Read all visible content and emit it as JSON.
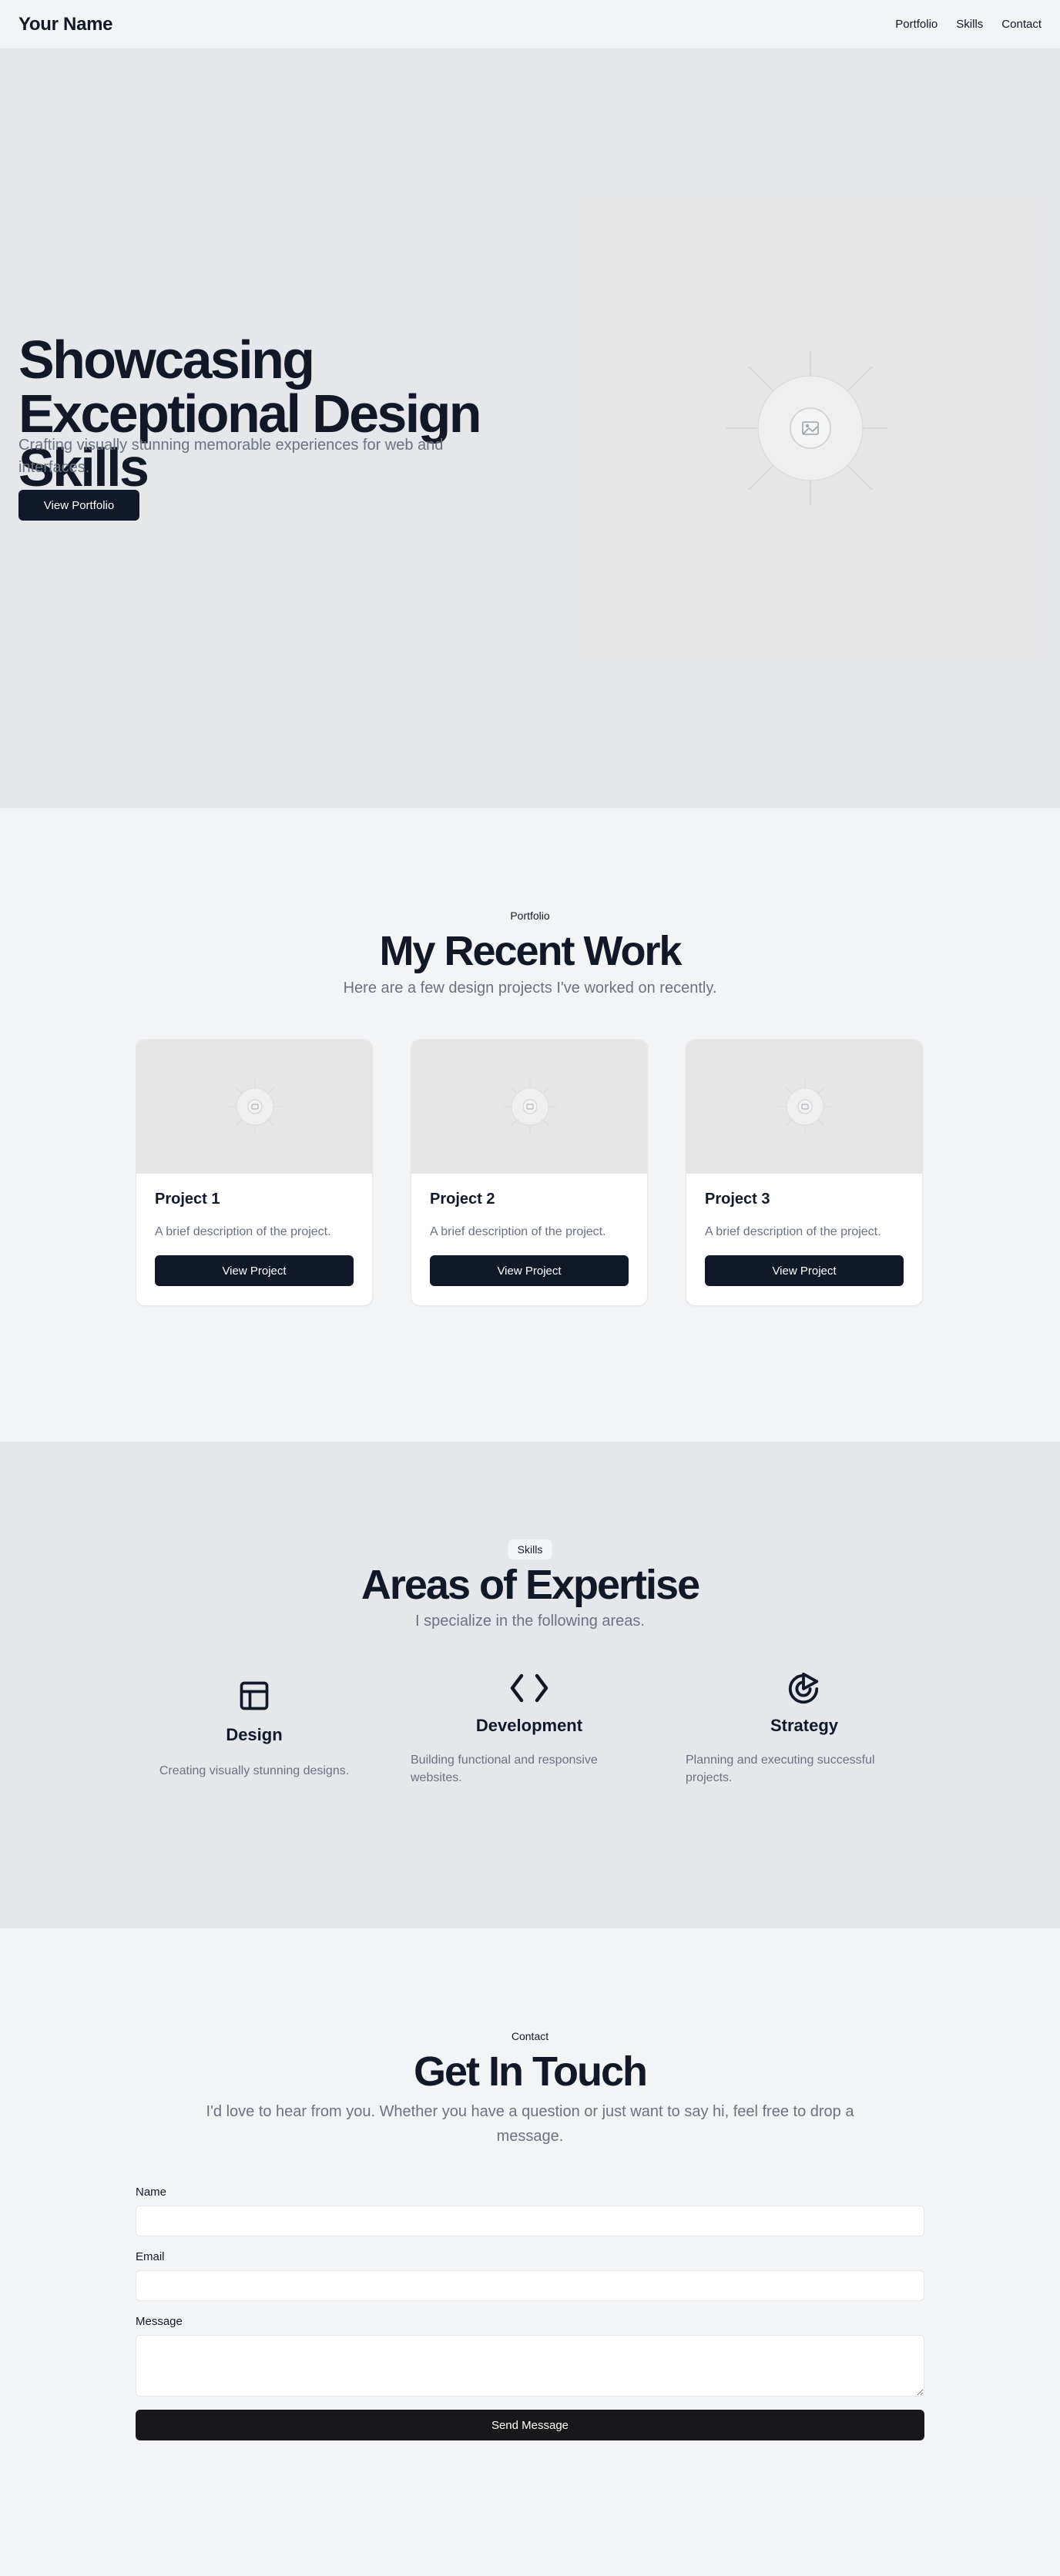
{
  "header": {
    "brand": "Your Name",
    "nav": [
      "Portfolio",
      "Skills",
      "Contact"
    ]
  },
  "hero": {
    "title": "Showcasing Exceptional Design Skills",
    "subtitle": "Crafting visually stunning memorable experiences for web and interfaces.",
    "button": "View Portfolio",
    "image_icon": "image-placeholder-icon"
  },
  "portfolio": {
    "badge": "Portfolio",
    "title": "My Recent Work",
    "subtitle": "Here are a few design projects I've worked on recently.",
    "projects": [
      {
        "title": "Project 1",
        "description": "A brief description of the project.",
        "button": "View Project"
      },
      {
        "title": "Project 2",
        "description": "A brief description of the project.",
        "button": "View Project"
      },
      {
        "title": "Project 3",
        "description": "A brief description of the project.",
        "button": "View Project"
      }
    ]
  },
  "skills": {
    "badge": "Skills",
    "title": "Areas of Expertise",
    "subtitle": "I specialize in the following areas.",
    "items": [
      {
        "icon": "layout-icon",
        "title": "Design",
        "description": "Creating visually stunning designs."
      },
      {
        "icon": "code-icon",
        "title": "Development",
        "description": "Building functional and responsive websites."
      },
      {
        "icon": "target-icon",
        "title": "Strategy",
        "description": "Planning and executing successful projects."
      }
    ]
  },
  "contact": {
    "badge": "Contact",
    "title": "Get In Touch",
    "subtitle": "I'd love to hear from you. Whether you have a question or just want to say hi, feel free to drop a message.",
    "fields": {
      "name_label": "Name",
      "name_value": "",
      "email_label": "Email",
      "email_value": "",
      "message_label": "Message",
      "message_value": ""
    },
    "button": "Send Message"
  },
  "colors": {
    "primary": "#111827",
    "muted": "#6b7280",
    "page": "#f3f4f6",
    "band": "#e5e7eb",
    "send_button": "#18181b"
  }
}
